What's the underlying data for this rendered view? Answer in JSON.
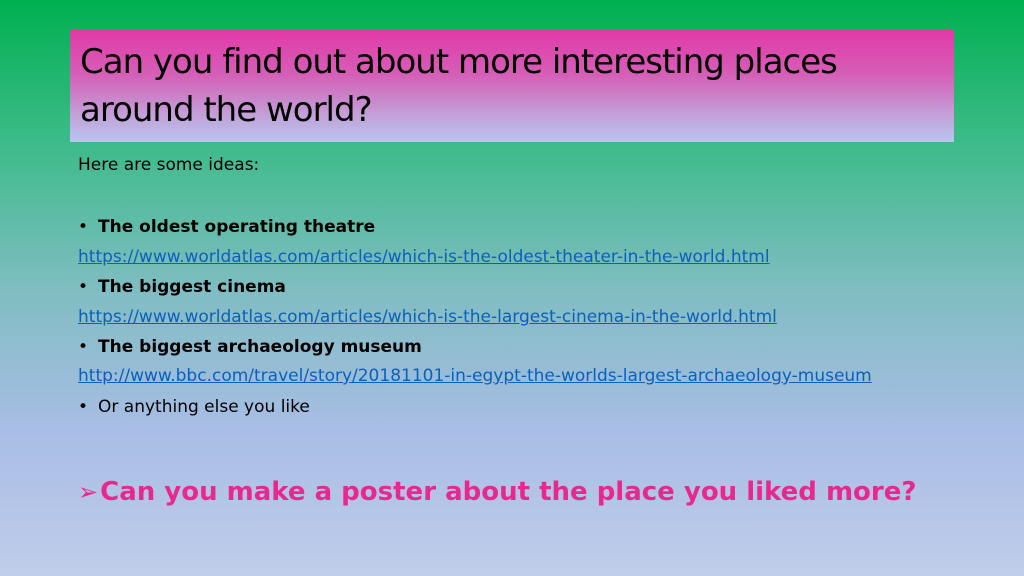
{
  "slide": {
    "title": "Can you find out about more interesting places around the world?",
    "intro": "Here are some ideas:",
    "items": [
      {
        "label": "The oldest operating theatre",
        "url": "https://www.worldatlas.com/articles/which-is-the-oldest-theater-in-the-world.html"
      },
      {
        "label": "The biggest cinema",
        "url": "https://www.worldatlas.com/articles/which-is-the-largest-cinema-in-the-world.html"
      },
      {
        "label": "The biggest archaeology museum",
        "url": "http://www.bbc.com/travel/story/20181101-in-egypt-the-worlds-largest-archaeology-museum"
      }
    ],
    "last_item": "Or anything else you like",
    "question": "Can you make a poster about the place you liked more?",
    "bullet_symbol": "•",
    "question_bullet_icon": "arrow-bullet-icon"
  }
}
